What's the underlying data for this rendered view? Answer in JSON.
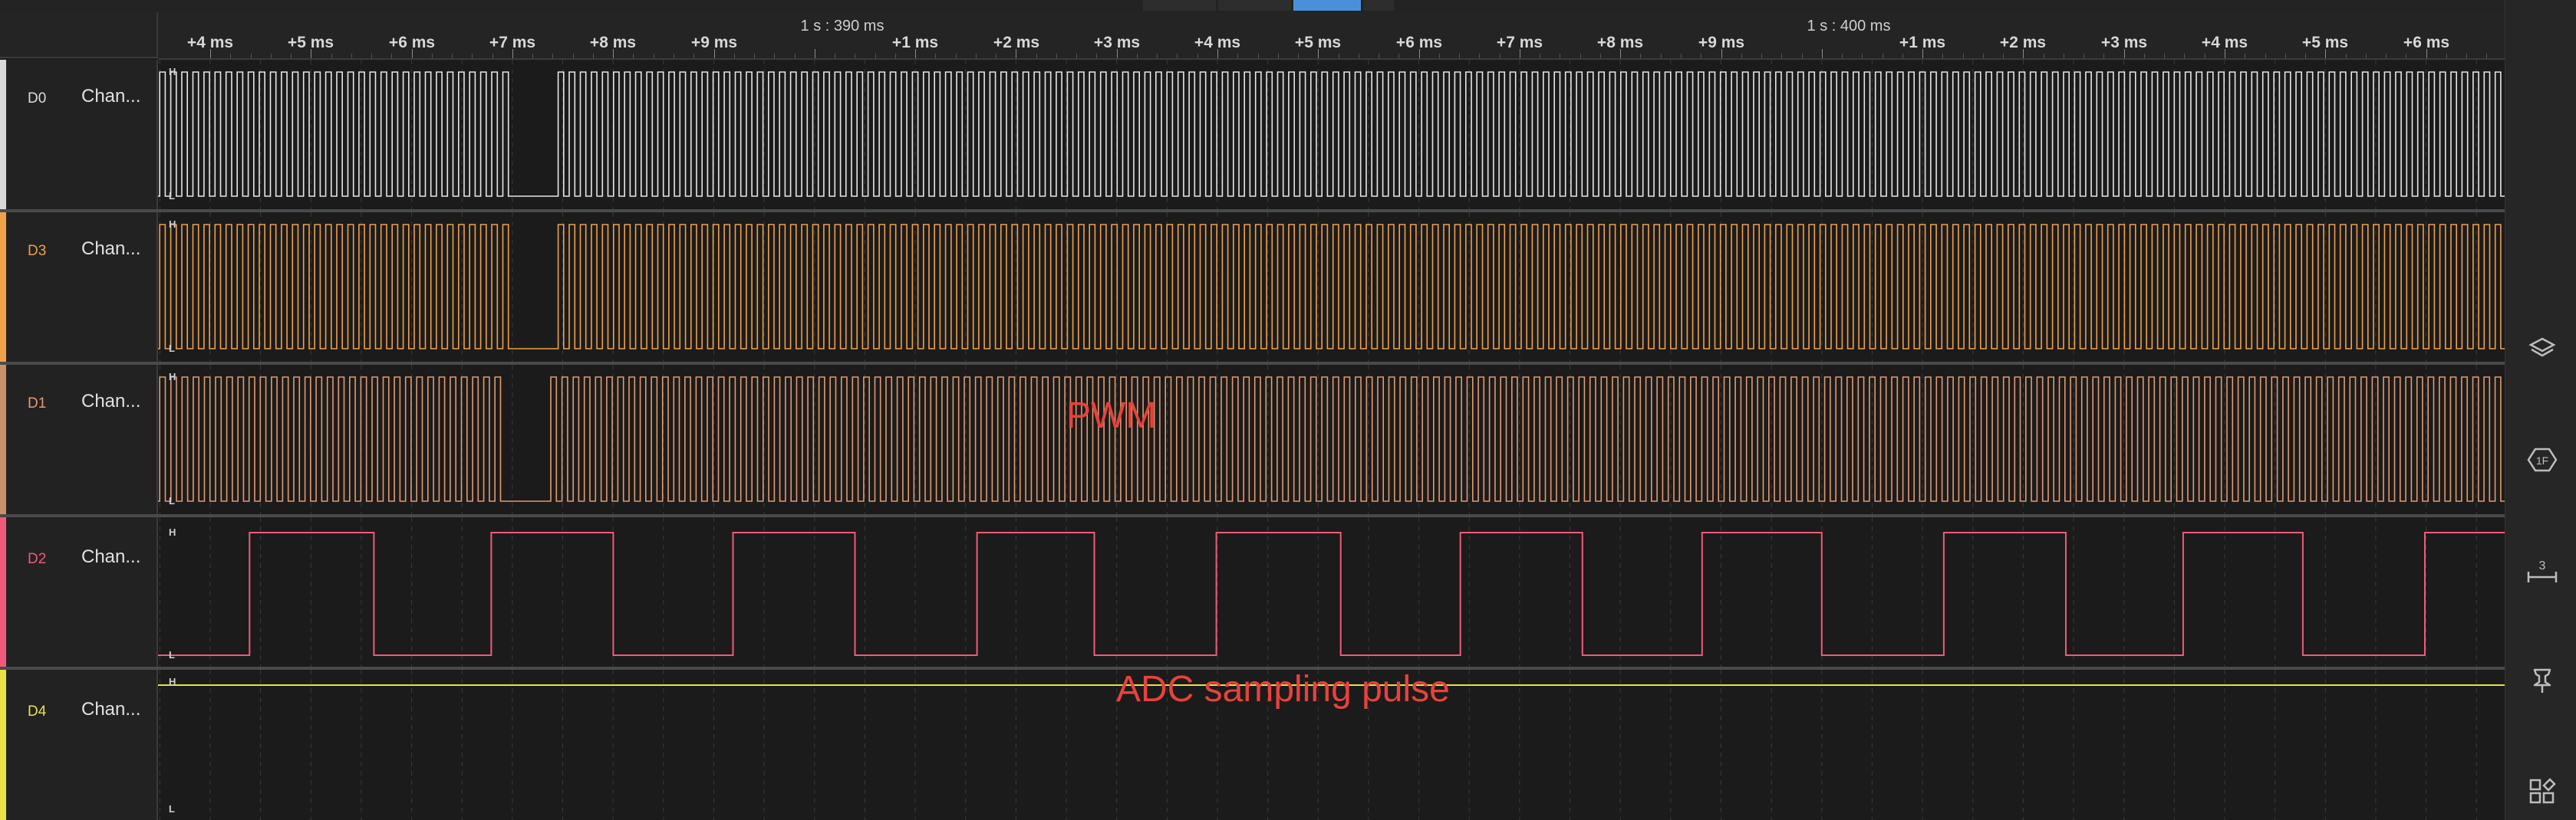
{
  "ruler": {
    "major_labels": [
      "1 s : 390 ms",
      "1 s : 400 ms"
    ],
    "tick_labels": [
      "+4 ms",
      "+5 ms",
      "+6 ms",
      "+7 ms",
      "+8 ms",
      "+9 ms",
      "+1 ms",
      "+2 ms",
      "+3 ms",
      "+4 ms",
      "+5 ms",
      "+6 ms",
      "+7 ms",
      "+8 ms",
      "+9 ms",
      "+1 ms",
      "+2 ms",
      "+3 ms",
      "+4 ms",
      "+5 ms",
      "+6 ms"
    ]
  },
  "level_labels": {
    "high": "H",
    "low": "L"
  },
  "channels": [
    {
      "id": "D0",
      "name": "Chan...",
      "color": "#e6e6e6",
      "wave": "dense",
      "pulses": 212,
      "gaps": [
        [
          0.148,
          0.169
        ]
      ]
    },
    {
      "id": "D3",
      "name": "Chan...",
      "color": "#f0a04b",
      "wave": "dense",
      "pulses": 212,
      "gaps": [
        [
          0.148,
          0.169
        ]
      ]
    },
    {
      "id": "D1",
      "name": "Chan...",
      "color": "#e39a6e",
      "wave": "dense",
      "pulses": 210,
      "gaps": [
        [
          0.143,
          0.162
        ]
      ]
    },
    {
      "id": "D2",
      "name": "Chan...",
      "color": "#f05a7a",
      "wave": "square",
      "high_ranges": [
        [
          0.039,
          0.092
        ],
        [
          0.142,
          0.194
        ],
        [
          0.245,
          0.297
        ],
        [
          0.349,
          0.399
        ],
        [
          0.451,
          0.504
        ],
        [
          0.555,
          0.607
        ],
        [
          0.658,
          0.709
        ],
        [
          0.761,
          0.813
        ],
        [
          0.863,
          0.914
        ],
        [
          0.966,
          1.0
        ]
      ]
    },
    {
      "id": "D4",
      "name": "Chan...",
      "color": "#e8e14a",
      "wave": "flat",
      "level": "high"
    }
  ],
  "annotations": {
    "pwm": "PWM",
    "adc": "ADC sampling pulse"
  },
  "sidebar": {
    "icons": [
      "layers-icon",
      "analyzer-icon",
      "measure-icon",
      "pin-icon",
      "grid-icon"
    ],
    "measure_count": "3"
  }
}
